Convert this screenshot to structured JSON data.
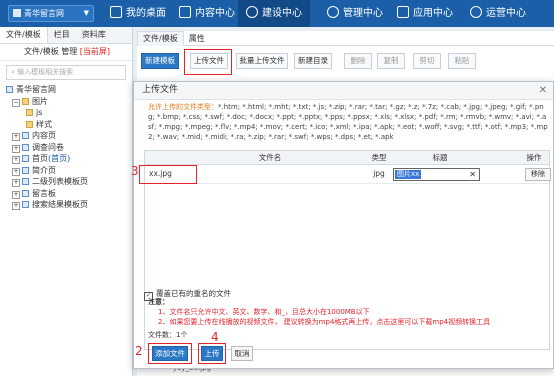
{
  "topbar": {
    "site_select": "青华留言网",
    "nav": [
      {
        "label": "我的桌面"
      },
      {
        "label": "内容中心"
      },
      {
        "label": "建设中心"
      },
      {
        "label": "管理中心"
      },
      {
        "label": "应用中心"
      },
      {
        "label": "运营中心"
      }
    ]
  },
  "left": {
    "tabs": [
      "文件/模板",
      "栏目",
      "资料库"
    ],
    "sub_label": "文件/模板 管理",
    "sub_status": "[当前屏]",
    "search_placeholder": "输入模板相关搜索",
    "tree": [
      {
        "label": "青华留言网"
      },
      {
        "label": "图片"
      },
      {
        "label": "js"
      },
      {
        "label": "样式"
      },
      {
        "label": "内容页"
      },
      {
        "label": "调查问卷"
      },
      {
        "label": "首页",
        "badge": "(首页)"
      },
      {
        "label": "简介页"
      },
      {
        "label": "二级列表模板页"
      },
      {
        "label": "留言板"
      },
      {
        "label": "搜索结果模板页"
      }
    ]
  },
  "right": {
    "tabs": [
      "文件/模板",
      "属性"
    ],
    "toolbar": {
      "new_template": "新建模板",
      "upload": "上传文件",
      "batch_upload": "批量上传文件",
      "new_dir": "新建目录",
      "delete": "删除",
      "copy": "复制",
      "cut": "剪切",
      "paste": "粘贴"
    },
    "bottom_file": "yay_56.jpg"
  },
  "modal": {
    "title": "上传文件",
    "allowed_label": "允许上传的文件类型：",
    "allowed_types": "*.htm; *.html; *.mht; *.txt; *.js; *.zip; *.rar; *.tar; *.gz; *.z; *.7z; *.cab; *.jpg; *.jpeg; *.gif; *.png; *.bmp; *.css; *.swf; *.doc; *.docx; *.ppt; *.pptx; *.pps; *.ppsx; *.xls; *.xlsx; *.pdf; *.rm; *.rmvb; *.wmv; *.avi; *.asf; *.mpg; *.mpeg; *.flv; *.mp4; *.mov; *.cert; *.ico; *.xml; *.ipa; *.apk; *.eot; *.woff; *.svg; *.ttf; *.otf; *.mp3; *.mp2; *.wav; *.mid; *.midi; *.ra; *.zip; *.rar; *.swf; *.wps; *.dps; *.et; *.apk",
    "headers": {
      "name": "文件名",
      "type": "类型",
      "title": "标题",
      "op": "操作"
    },
    "row": {
      "name": "xx.jpg",
      "type": "jpg",
      "title": "图片xx",
      "remove": "移除"
    },
    "overwrite": "覆盖已有的重名的文件",
    "notes_title": "注意：",
    "note1": "1、文件名只允许中文、英文、数字、和_，且总大小在1000MB以下",
    "note2_a": "2、如果您要上传在线播放的视频文件， 建议转换为mp4格式再上传，",
    "note2_b": "点击这里可以下载mp4视频转换工具",
    "file_count": "文件数：1个",
    "add_file": "添加文件",
    "upload": "上传",
    "cancel": "取消"
  },
  "annotations": {
    "n2": "2",
    "n3": "3",
    "n4": "4"
  },
  "colors": {
    "header_blue": "#1b5fa8",
    "button_blue": "#2b78c5",
    "annotation_red": "#e5232c"
  }
}
